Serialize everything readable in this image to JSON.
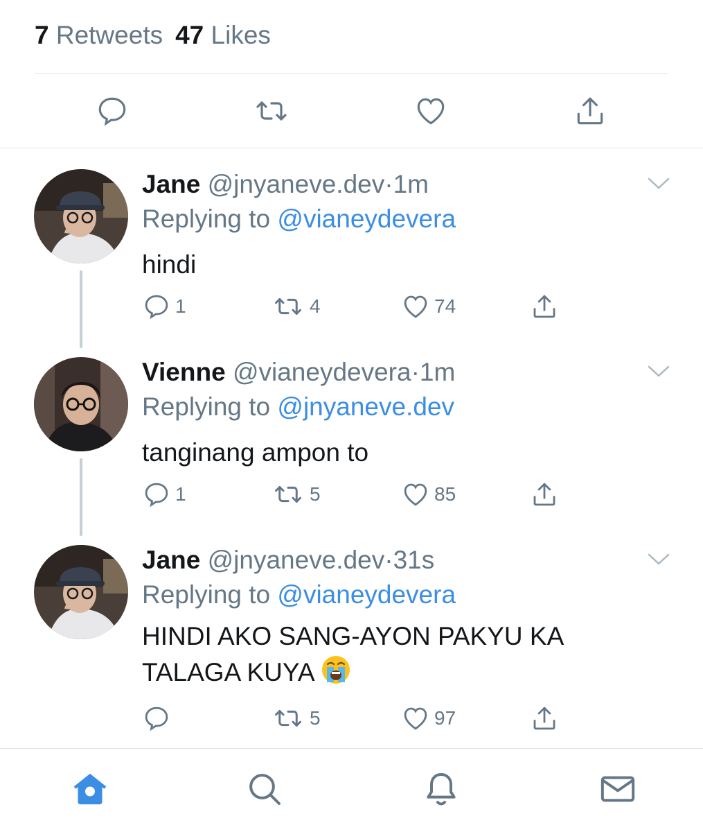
{
  "stats": {
    "retweets_count": "7",
    "retweets_label": "Retweets",
    "likes_count": "47",
    "likes_label": "Likes"
  },
  "main_actions": [
    "reply-icon",
    "retweet-icon",
    "like-icon",
    "share-icon"
  ],
  "replying_prefix": "Replying to",
  "tweets": [
    {
      "name": "Jane",
      "handle": "@jnyaneve.dev",
      "dot": "·",
      "time": "1m",
      "replying_to": "@vianeydevera",
      "text": "hindi",
      "replies": "1",
      "retweets": "4",
      "likes": "74"
    },
    {
      "name": "Vienne",
      "handle": "@vianeydevera",
      "dot": "·",
      "time": "1m",
      "replying_to": "@jnyaneve.dev",
      "text": "tanginang ampon to",
      "replies": "1",
      "retweets": "5",
      "likes": "85"
    },
    {
      "name": "Jane",
      "handle": "@jnyaneve.dev",
      "dot": "·",
      "time": "31s",
      "replying_to": "@vianeydevera",
      "text_line1": "HINDI AKO SANG-AYON PAKYU KA",
      "text_line2": "TALAGA KUYA",
      "emoji": "loudly-crying-face",
      "replies": "",
      "retweets": "5",
      "likes": "97"
    }
  ],
  "tabbar": [
    "home-icon",
    "search-icon",
    "notifications-icon",
    "messages-icon"
  ],
  "colors": {
    "accent": "#3b8ee3",
    "muted": "#657786",
    "text": "#14171a",
    "thread": "#c4cfd6"
  }
}
